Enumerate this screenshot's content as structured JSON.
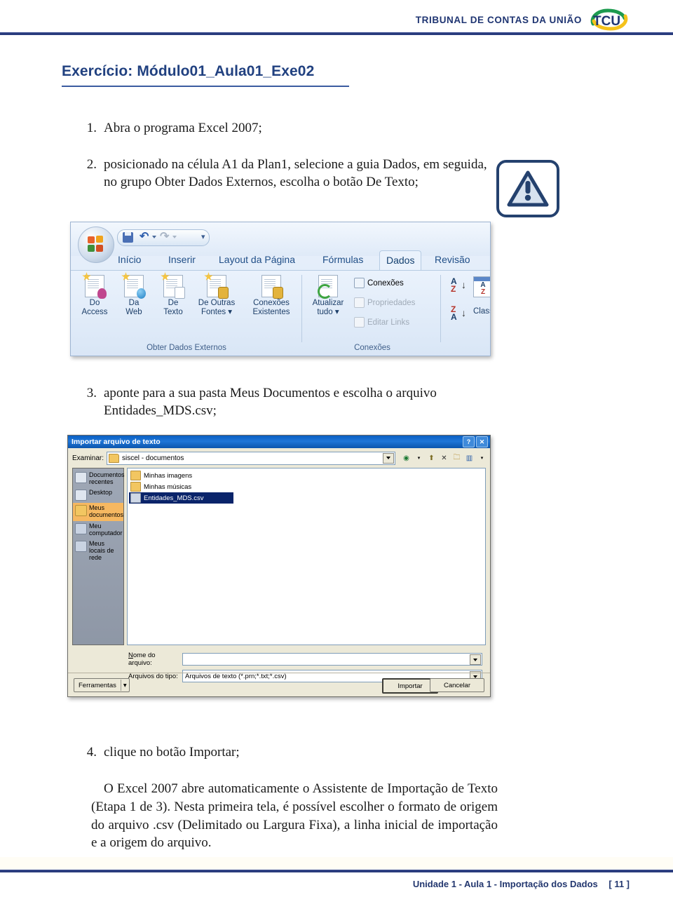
{
  "header": {
    "brand_text": "TRIBUNAL DE CONTAS DA UNIÃO",
    "logo_text": "TCU",
    "logo_green": "#1d9b4f",
    "logo_yellow": "#f5c21b",
    "logo_blue": "#1f3572"
  },
  "page": {
    "title": "Exercício: Módulo01_Aula01_Exe02",
    "title_color": "#214180",
    "accent_rule_color": "#2a3c7d"
  },
  "steps": [
    {
      "num": "1.",
      "text": "Abra o programa Excel 2007;"
    },
    {
      "num": "2.",
      "text": "posicionado na célula A1 da Plan1, selecione a guia Dados, em seguida, no grupo Obter Dados Externos, escolha o botão De Texto;"
    },
    {
      "num": "3.",
      "text": "aponte para a sua pasta Meus Documentos e escolha o arquivo Entidades_MDS.csv;"
    },
    {
      "num": "4.",
      "text": "clique no botão Importar;"
    }
  ],
  "paragraph": "O Excel 2007 abre automaticamente o Assistente de Importação de Texto (Etapa 1 de 3). Nesta primeira tela, é possível escolher o formato de origem do arquivo .csv (Delimitado ou Largura Fixa), a linha inicial de importação e a origem do arquivo.",
  "warning_icon": {
    "name": "warning-triangle-icon",
    "border_color": "#24416e",
    "fill_color": "#d7e2ef"
  },
  "ribbon": {
    "office_button": "office-orb-icon",
    "quick_access": [
      {
        "name": "save-icon",
        "label": "Salvar"
      },
      {
        "name": "undo-icon",
        "label": "Desfazer"
      },
      {
        "name": "redo-icon",
        "label": "Refazer"
      },
      {
        "name": "customize-qat-icon",
        "label": "Personalizar"
      }
    ],
    "tabs": [
      {
        "label": "Início",
        "active": false
      },
      {
        "label": "Inserir",
        "active": false
      },
      {
        "label": "Layout da Página",
        "active": false
      },
      {
        "label": "Fórmulas",
        "active": false
      },
      {
        "label": "Dados",
        "active": true
      },
      {
        "label": "Revisão",
        "active": false
      }
    ],
    "groups": [
      {
        "label": "Obter Dados Externos",
        "buttons": [
          {
            "line1": "Do",
            "line2": "Access"
          },
          {
            "line1": "Da",
            "line2": "Web"
          },
          {
            "line1": "De",
            "line2": "Texto"
          },
          {
            "line1": "De Outras",
            "line2": "Fontes ▾"
          },
          {
            "line1": "Conexões",
            "line2": "Existentes"
          }
        ]
      },
      {
        "label": "Conexões",
        "buttons": [
          {
            "line1": "Atualizar",
            "line2": "tudo ▾"
          }
        ],
        "small_items": [
          {
            "label": "Conexões",
            "disabled": false
          },
          {
            "label": "Propriedades",
            "disabled": true
          },
          {
            "label": "Editar Links",
            "disabled": true
          }
        ]
      },
      {
        "label": "",
        "sort": [
          {
            "label": "A\nZ",
            "dir": "asc"
          },
          {
            "label": "Z\nA",
            "dir": "desc"
          },
          {
            "label": "Class"
          }
        ]
      }
    ]
  },
  "dialog": {
    "title": "Importar arquivo de texto",
    "help_button": "?",
    "close_button": "✕",
    "look_in_label": "Examinar:",
    "look_in_value": "siscel - documentos",
    "toolbar_icons": [
      "back-icon",
      "up-one-level-icon",
      "delete-icon",
      "new-folder-icon",
      "views-icon"
    ],
    "places": [
      {
        "label": "Documentos recentes",
        "selected": false,
        "icon": "recent-documents-icon"
      },
      {
        "label": "Desktop",
        "selected": false,
        "icon": "desktop-icon"
      },
      {
        "label": "Meus documentos",
        "selected": true,
        "icon": "my-documents-icon"
      },
      {
        "label": "Meu computador",
        "selected": false,
        "icon": "my-computer-icon"
      },
      {
        "label": "Meus locais de rede",
        "selected": false,
        "icon": "network-places-icon"
      }
    ],
    "files": [
      {
        "name": "Minhas imagens",
        "type": "folder",
        "selected": false
      },
      {
        "name": "Minhas músicas",
        "type": "folder",
        "selected": false
      },
      {
        "name": "Entidades_MDS.csv",
        "type": "csv",
        "selected": true
      }
    ],
    "file_name_label": "Nome do arquivo:",
    "file_name_value": "",
    "file_type_label": "Arquivos do tipo:",
    "file_type_value": "Arquivos de texto (*.prn;*.txt;*.csv)",
    "tools_button": "Ferramentas",
    "import_button": "Importar",
    "cancel_button": "Cancelar"
  },
  "footer": {
    "text": "Unidade 1 - Aula 1 - Importação dos Dados",
    "page": "[ 11 ]"
  }
}
